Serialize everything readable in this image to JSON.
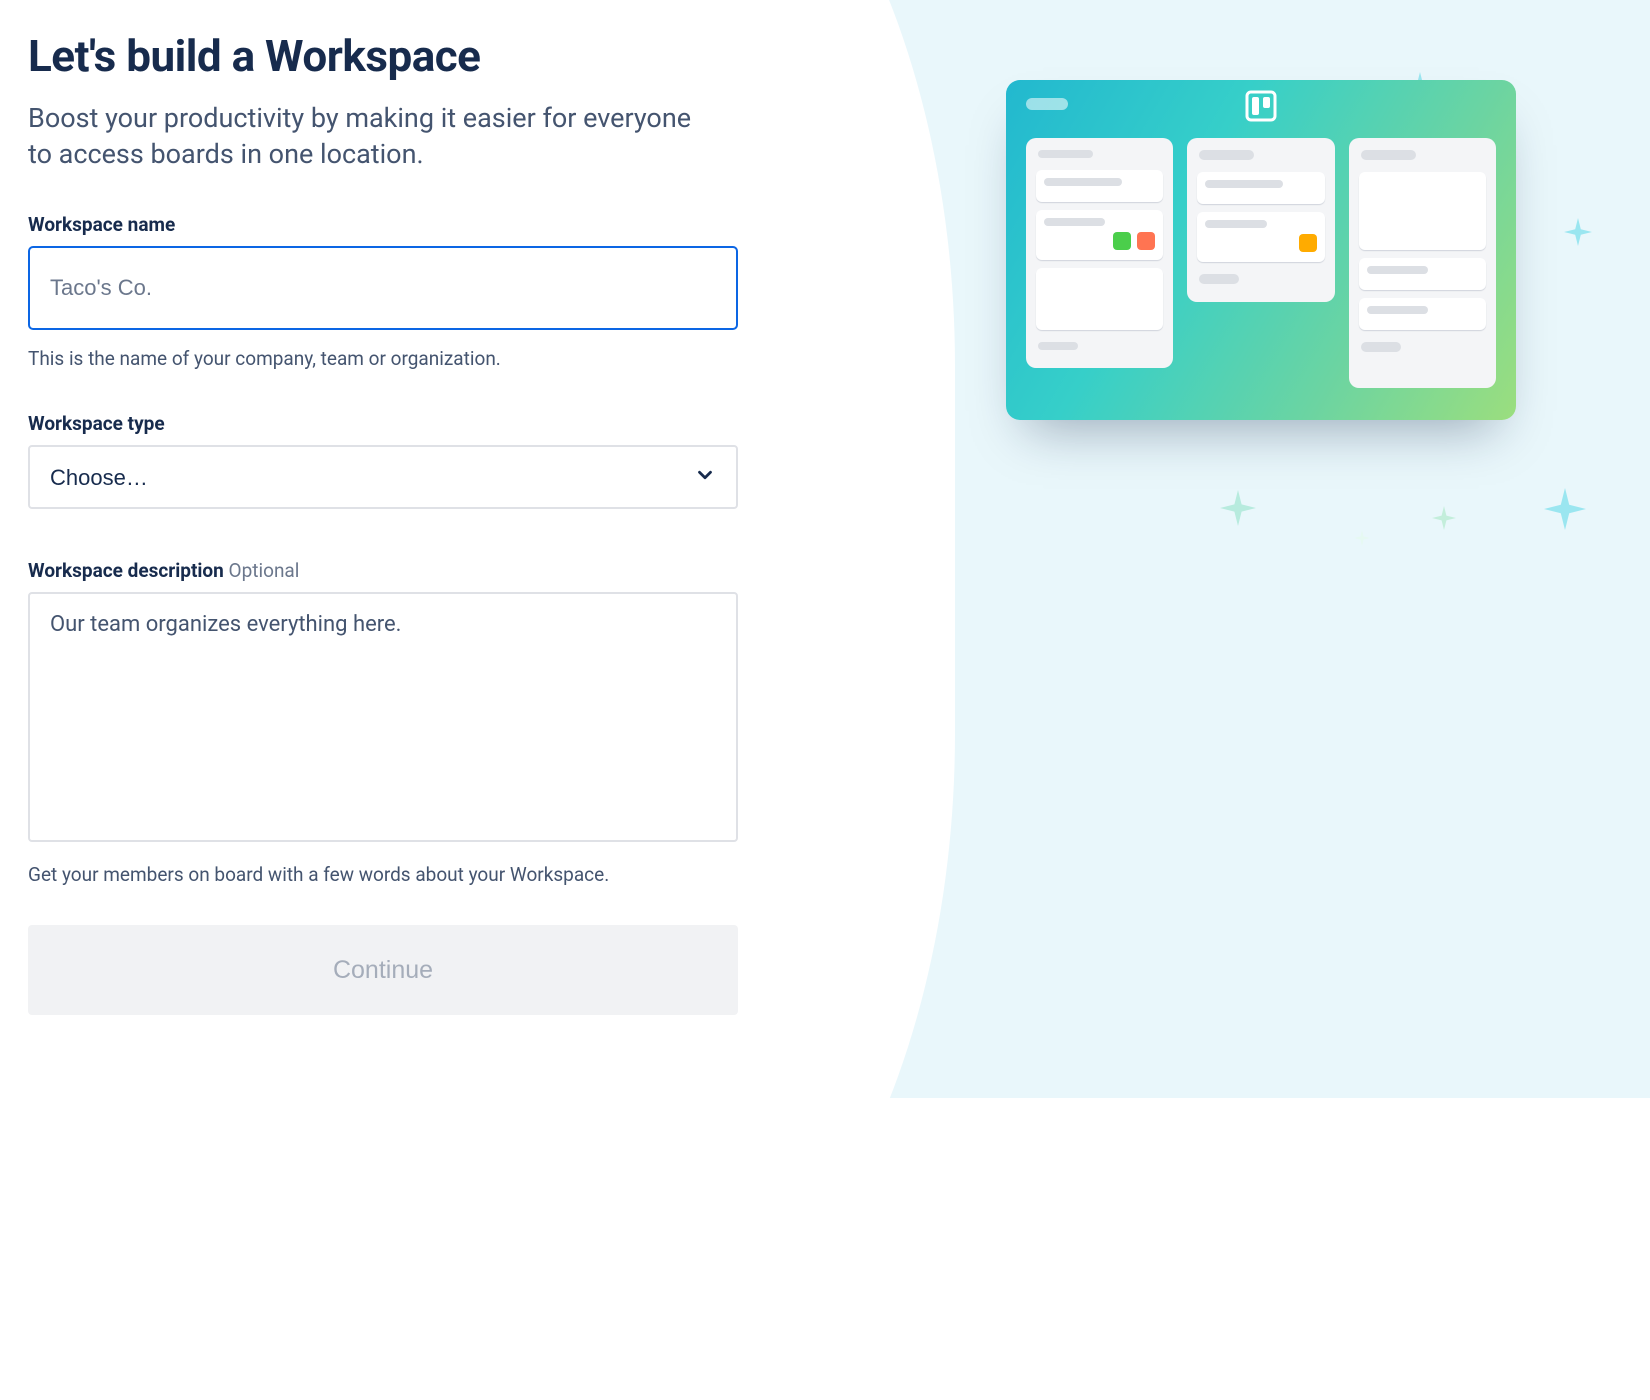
{
  "header": {
    "title": "Let's build a Workspace",
    "subtitle": "Boost your productivity by making it easier for everyone to access boards in one location."
  },
  "form": {
    "name": {
      "label": "Workspace name",
      "placeholder": "Taco's Co.",
      "value": "",
      "helper": "This is the name of your company, team or organization."
    },
    "type": {
      "label": "Workspace type",
      "selected": "Choose…"
    },
    "description": {
      "label": "Workspace description",
      "optional_tag": "Optional",
      "placeholder": "Our team organizes everything here.",
      "helper": "Get your members on board with a few words about your Workspace."
    },
    "submit_label": "Continue"
  },
  "illustration": {
    "icon": "trello-logo"
  }
}
